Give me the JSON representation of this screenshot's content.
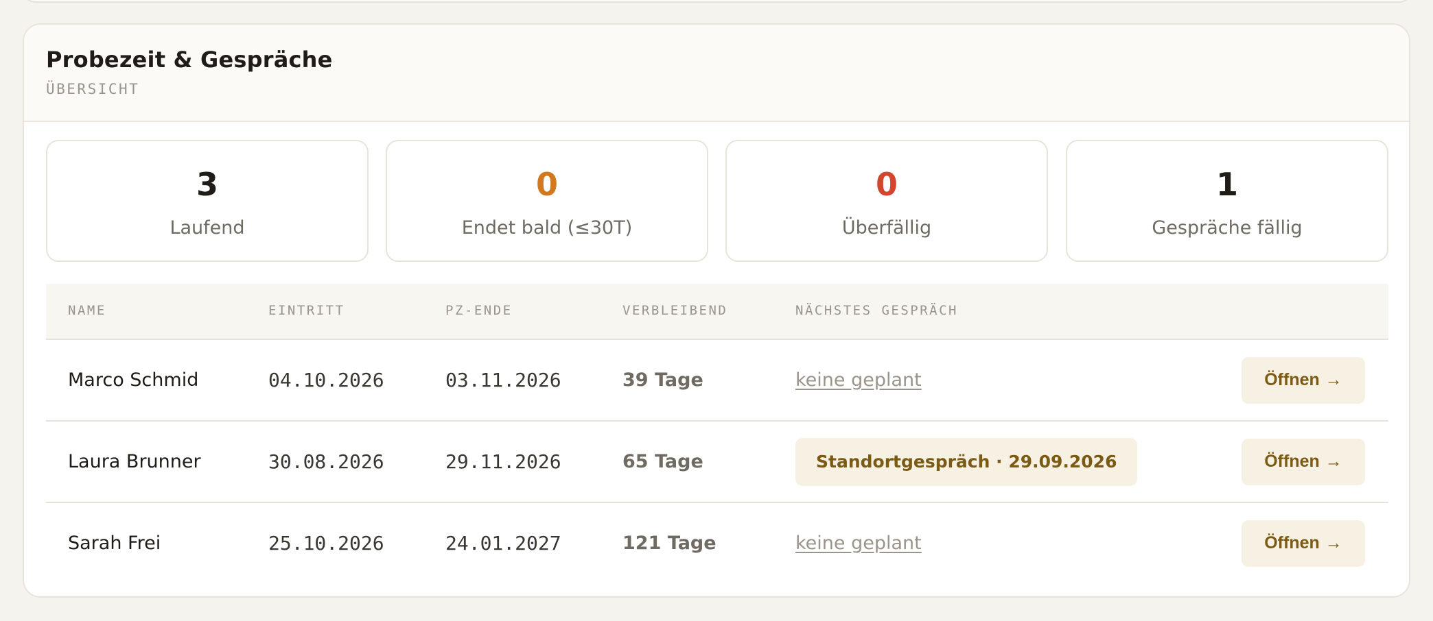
{
  "section": {
    "title": "Probezeit & Gespräche",
    "subtitle": "ÜBERSICHT"
  },
  "stats": [
    {
      "value": "3",
      "label": "Laufend",
      "color": "#1f1c17"
    },
    {
      "value": "0",
      "label": "Endet bald (≤30T)",
      "color": "#d2781e"
    },
    {
      "value": "0",
      "label": "Überfällig",
      "color": "#d2462f"
    },
    {
      "value": "1",
      "label": "Gespräche fällig",
      "color": "#1f1c17"
    }
  ],
  "table": {
    "headers": {
      "name": "NAME",
      "eintritt": "EINTRITT",
      "pz_ende": "PZ-ENDE",
      "verbleibend": "VERBLEIBEND",
      "naechstes": "NÄCHSTES GESPRÄCH"
    },
    "rows": [
      {
        "name": "Marco Schmid",
        "eintritt": "04.10.2026",
        "pz_ende": "03.11.2026",
        "verbleibend": "39 Tage",
        "gespraech": "keine geplant",
        "action": "Öffnen",
        "action_icon": "→"
      },
      {
        "name": "Laura Brunner",
        "eintritt": "30.08.2026",
        "pz_ende": "29.11.2026",
        "verbleibend": "65 Tage",
        "gespraech": "Standortgespräch · 29.09.2026",
        "action": "Öffnen",
        "action_icon": "→"
      },
      {
        "name": "Sarah Frei",
        "eintritt": "25.10.2026",
        "pz_ende": "24.01.2027",
        "verbleibend": "121 Tage",
        "gespraech": "keine geplant",
        "action": "Öffnen",
        "action_icon": "→"
      }
    ]
  },
  "colors": {
    "accent": "#7a5a14",
    "accent_bg": "#f6f1e2",
    "warning": "#d2781e",
    "danger": "#d2462f"
  }
}
